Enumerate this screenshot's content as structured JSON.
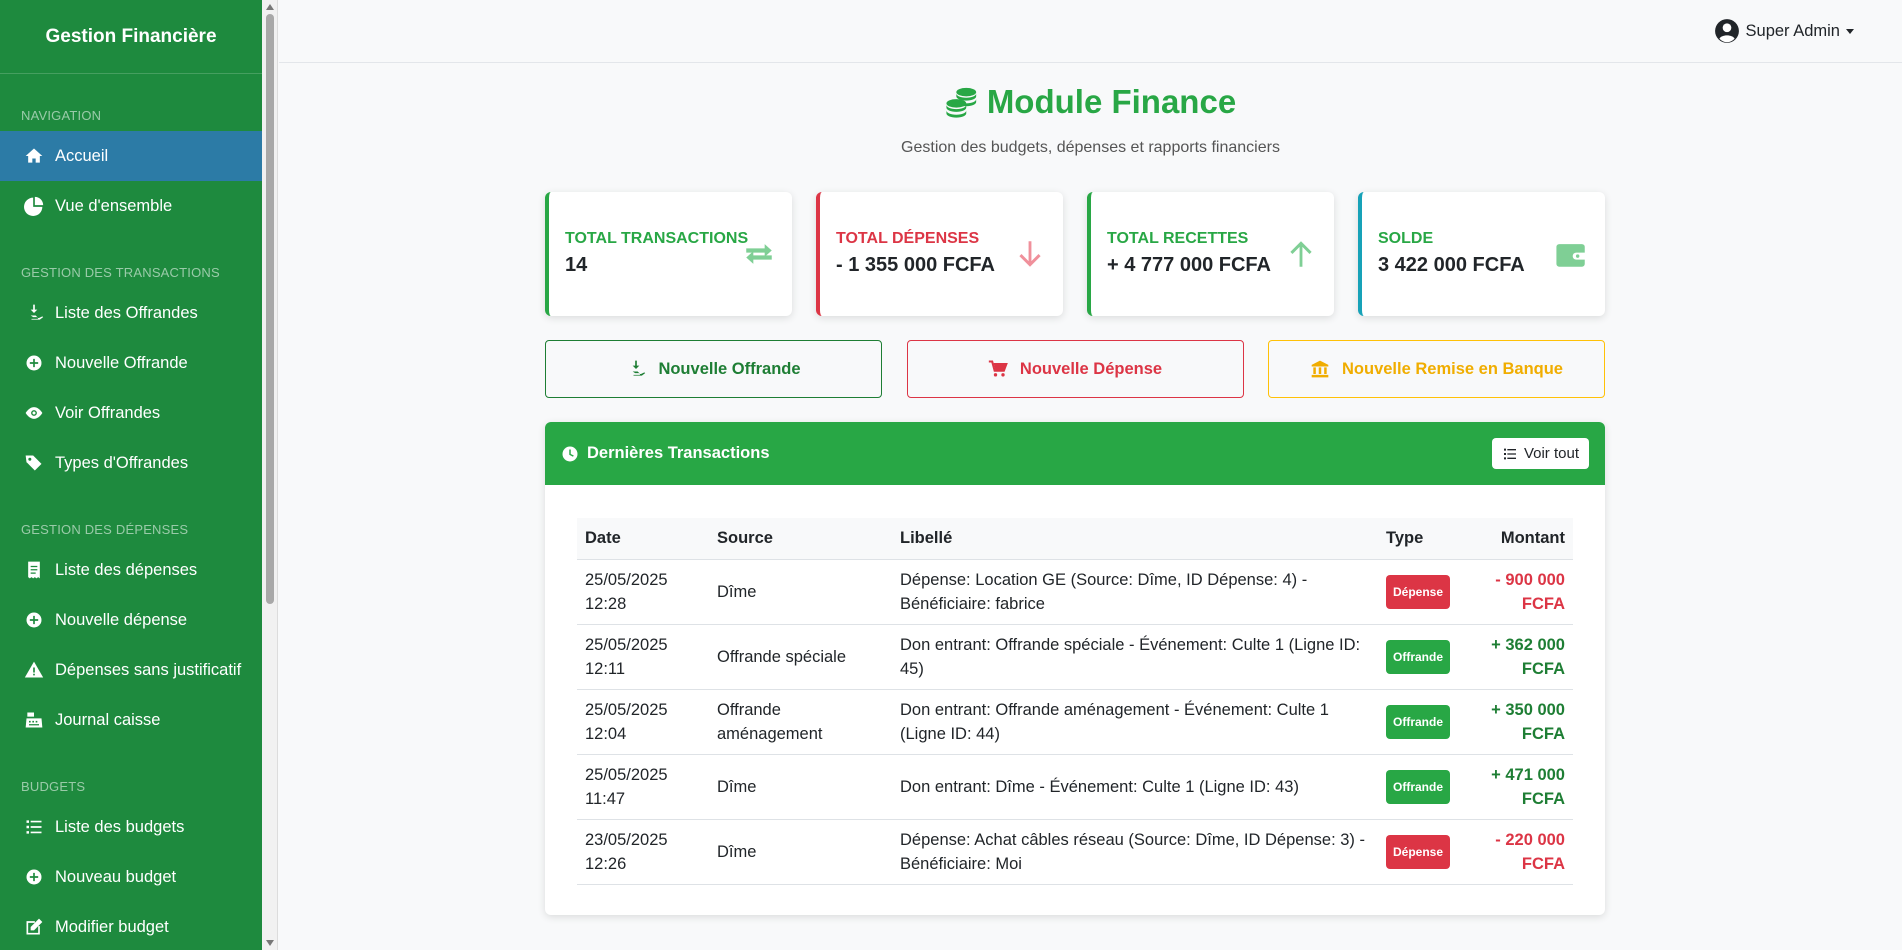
{
  "sidebar": {
    "brand": "Gestion Financière",
    "sections": [
      {
        "title": "NAVIGATION",
        "items": [
          {
            "label": "Accueil",
            "icon": "home-icon"
          },
          {
            "label": "Vue d'ensemble",
            "icon": "pie-chart-icon"
          }
        ]
      },
      {
        "title": "GESTION DES TRANSACTIONS",
        "items": [
          {
            "label": "Liste des Offrandes",
            "icon": "hand-coin-icon"
          },
          {
            "label": "Nouvelle Offrande",
            "icon": "plus-circle-icon"
          },
          {
            "label": "Voir Offrandes",
            "icon": "eye-icon"
          },
          {
            "label": "Types d'Offrandes",
            "icon": "tags-icon"
          }
        ]
      },
      {
        "title": "GESTION DES DÉPENSES",
        "items": [
          {
            "label": "Liste des dépenses",
            "icon": "receipt-icon"
          },
          {
            "label": "Nouvelle dépense",
            "icon": "plus-circle-icon"
          },
          {
            "label": "Dépenses sans justificatif",
            "icon": "warning-icon"
          },
          {
            "label": "Journal caisse",
            "icon": "cash-register-icon"
          }
        ]
      },
      {
        "title": "BUDGETS",
        "items": [
          {
            "label": "Liste des budgets",
            "icon": "list-icon"
          },
          {
            "label": "Nouveau budget",
            "icon": "plus-circle-icon"
          },
          {
            "label": "Modifier budget",
            "icon": "edit-icon"
          }
        ]
      }
    ]
  },
  "topbar": {
    "user": "Super Admin"
  },
  "header": {
    "title": "Module Finance",
    "subtitle": "Gestion des budgets, dépenses et rapports financiers"
  },
  "stats": [
    {
      "label": "TOTAL TRANSACTIONS",
      "value": "14",
      "color": "#28a745",
      "icon": "exchange-icon"
    },
    {
      "label": "TOTAL DÉPENSES",
      "value": "- 1 355 000 FCFA",
      "color": "#dc3545",
      "icon": "arrow-down-icon"
    },
    {
      "label": "TOTAL RECETTES",
      "value": "+ 4 777 000 FCFA",
      "color": "#28a745",
      "icon": "arrow-up-icon"
    },
    {
      "label": "SOLDE",
      "value": "3 422 000 FCFA",
      "color": "#17a2b8",
      "icon": "wallet-icon"
    }
  ],
  "actions": {
    "offrande": "Nouvelle Offrande",
    "depense": "Nouvelle Dépense",
    "remise": "Nouvelle Remise en Banque"
  },
  "transactions": {
    "title": "Dernières Transactions",
    "view_all": "Voir tout",
    "columns": {
      "date": "Date",
      "source": "Source",
      "label": "Libellé",
      "type": "Type",
      "amount": "Montant"
    },
    "rows": [
      {
        "date": "25/05/2025",
        "time": "12:28",
        "source": "Dîme",
        "label": "Dépense: Location GE (Source: Dîme, ID Dépense: 4) - Bénéficiaire: fabrice",
        "type": "Dépense",
        "amount": "- 900 000",
        "currency": "FCFA"
      },
      {
        "date": "25/05/2025",
        "time": "12:11",
        "source": "Offrande spéciale",
        "label": "Don entrant: Offrande spéciale - Événement: Culte 1 (Ligne ID: 45)",
        "type": "Offrande",
        "amount": "+ 362 000",
        "currency": "FCFA"
      },
      {
        "date": "25/05/2025",
        "time": "12:04",
        "source": "Offrande aménagement",
        "label": "Don entrant: Offrande aménagement - Événement: Culte 1 (Ligne ID: 44)",
        "type": "Offrande",
        "amount": "+ 350 000",
        "currency": "FCFA"
      },
      {
        "date": "25/05/2025",
        "time": "11:47",
        "source": "Dîme",
        "label": "Don entrant: Dîme - Événement: Culte 1 (Ligne ID: 43)",
        "type": "Offrande",
        "amount": "+ 471 000",
        "currency": "FCFA"
      },
      {
        "date": "23/05/2025",
        "time": "12:26",
        "source": "Dîme",
        "label": "Dépense: Achat câbles réseau (Source: Dîme, ID Dépense: 3) - Bénéficiaire: Moi",
        "type": "Dépense",
        "amount": "- 220 000",
        "currency": "FCFA"
      }
    ]
  }
}
